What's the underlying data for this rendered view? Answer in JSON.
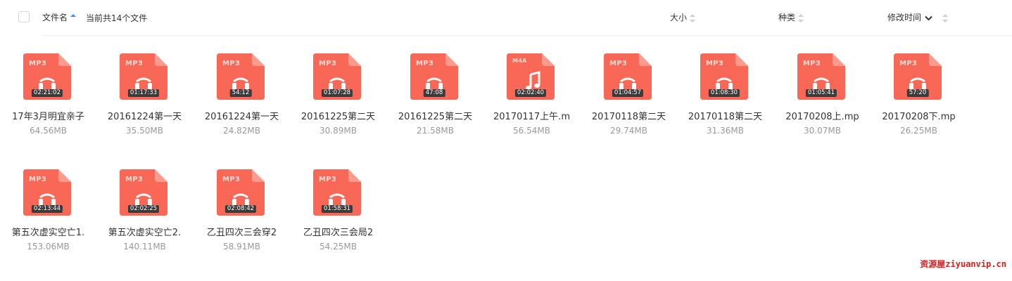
{
  "header": {
    "name_label": "文件名",
    "count_label": "当前共14个文件",
    "size_label": "大小",
    "type_label": "种类",
    "mtime_label": "修改时间"
  },
  "files": [
    {
      "type": "MP3",
      "duration": "02:21:02",
      "name": "17年3月明宜亲子",
      "size": "64.56MB"
    },
    {
      "type": "MP3",
      "duration": "01:17:33",
      "name": "20161224第一天",
      "size": "35.50MB"
    },
    {
      "type": "MP3",
      "duration": "54:12",
      "name": "20161224第一天",
      "size": "24.82MB"
    },
    {
      "type": "MP3",
      "duration": "01:07:28",
      "name": "20161225第二天",
      "size": "30.89MB"
    },
    {
      "type": "MP3",
      "duration": "47:08",
      "name": "20161225第二天",
      "size": "21.58MB"
    },
    {
      "type": "M4A",
      "duration": "02:02:40",
      "name": "20170117上午.m",
      "size": "56.54MB"
    },
    {
      "type": "MP3",
      "duration": "01:04:57",
      "name": "20170118第二天",
      "size": "29.74MB"
    },
    {
      "type": "MP3",
      "duration": "01:08:30",
      "name": "20170118第二天",
      "size": "31.36MB"
    },
    {
      "type": "MP3",
      "duration": "01:05:41",
      "name": "20170208上.mp",
      "size": "30.07MB"
    },
    {
      "type": "MP3",
      "duration": "57:20",
      "name": "20170208下.mp",
      "size": "26.25MB"
    },
    {
      "type": "MP3",
      "duration": "02:13:44",
      "name": "第五次虚实空亡1.",
      "size": "153.06MB"
    },
    {
      "type": "MP3",
      "duration": "02:02:25",
      "name": "第五次虚实空亡2.",
      "size": "140.11MB"
    },
    {
      "type": "MP3",
      "duration": "02:08:42",
      "name": "乙丑四次三会穿2",
      "size": "58.91MB"
    },
    {
      "type": "MP3",
      "duration": "01:58:31",
      "name": "乙丑四次三会局2",
      "size": "54.25MB"
    }
  ],
  "watermark": "资源屋ziyuanvip.cn",
  "colors": {
    "file_icon": "#f96757",
    "file_icon_fold": "#ff9a8c",
    "accent": "#3b8cff",
    "watermark": "#e01d1d"
  }
}
